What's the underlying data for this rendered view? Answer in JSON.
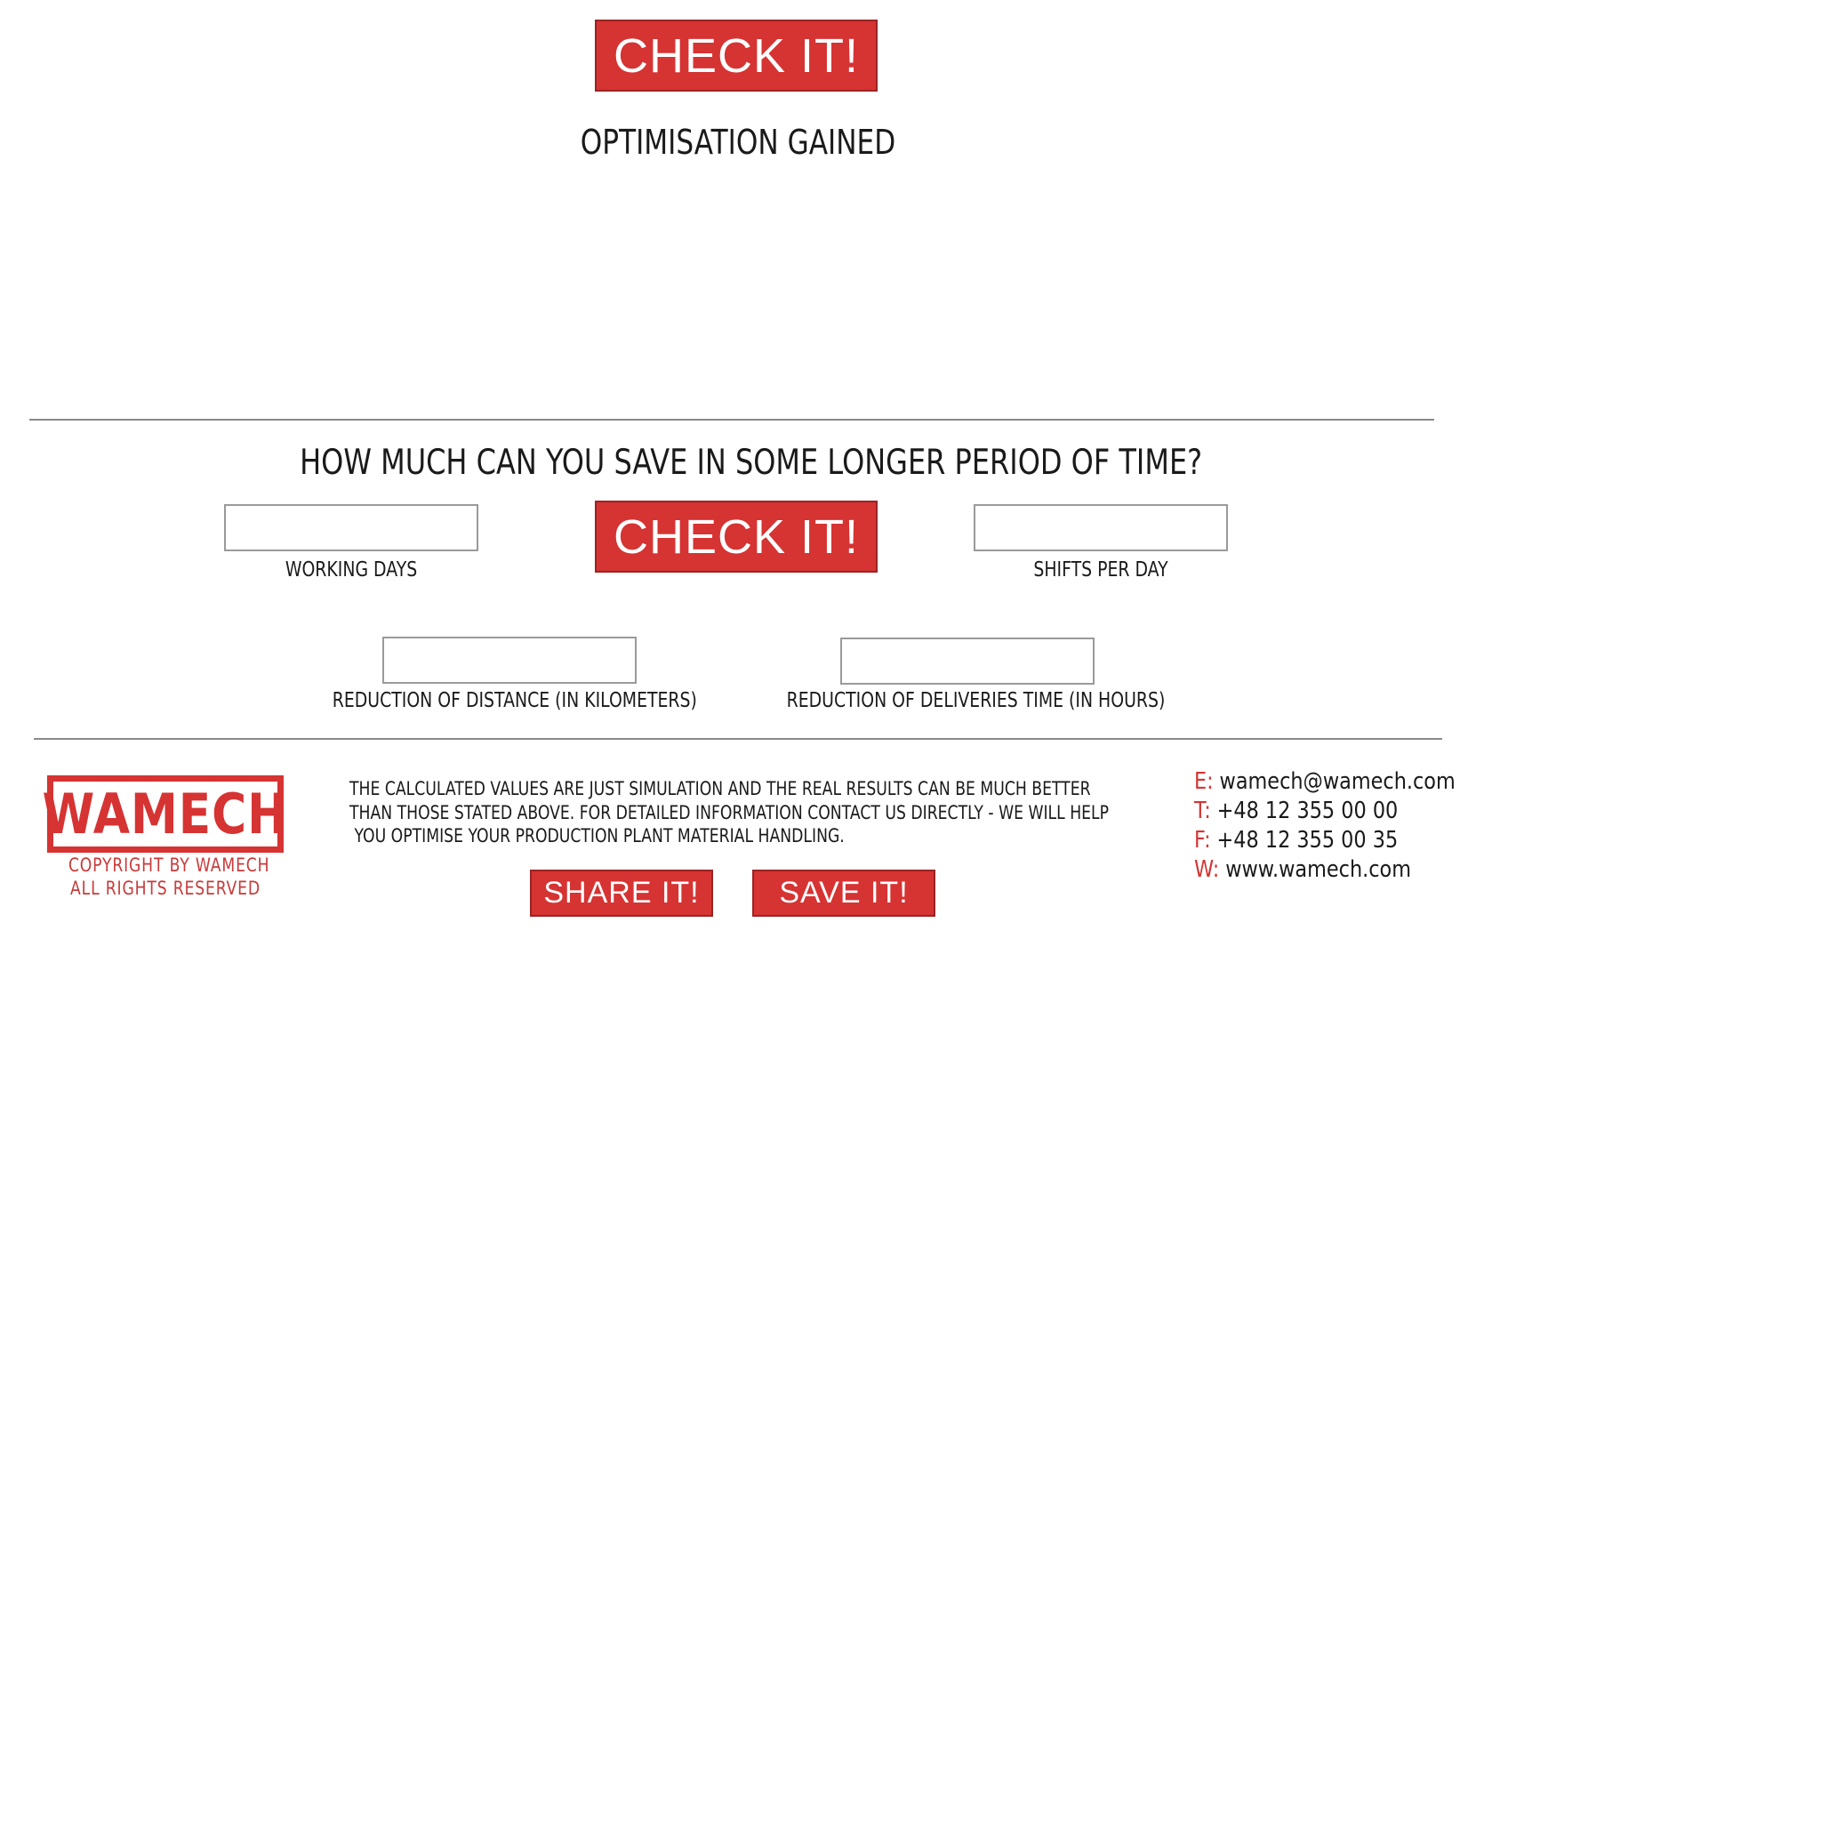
{
  "top": {
    "check_button_label": "CHECK IT!",
    "result_title": "OPTIMISATION GAINED"
  },
  "period": {
    "question": "HOW MUCH CAN YOU SAVE IN SOME LONGER PERIOD OF TIME?",
    "check_button_label": "CHECK IT!",
    "fields": {
      "working_days": {
        "label": "WORKING DAYS",
        "value": ""
      },
      "shifts_per_day": {
        "label": "SHIFTS PER DAY",
        "value": ""
      },
      "distance_reduction": {
        "label": "REDUCTION OF DISTANCE (IN KILOMETERS)",
        "value": ""
      },
      "delivery_time_reduction": {
        "label": "REDUCTION OF DELIVERIES TIME  (IN HOURS)",
        "value": ""
      }
    }
  },
  "footer": {
    "logo_text": "WAMECH",
    "copyright_line1": "COPYRIGHT BY WAMECH",
    "copyright_line2": "ALL RIGHTS RESERVED",
    "disclaimer_lines": [
      "THE CALCULATED VALUES ARE JUST SIMULATION AND THE REAL RESULTS CAN BE MUCH BETTER",
      "THAN THOSE STATED ABOVE. FOR DETAILED INFORMATION CONTACT US DIRECTLY - WE WILL HELP",
      " YOU OPTIMISE YOUR PRODUCTION PLANT MATERIAL HANDLING."
    ],
    "share_button_label": "SHARE IT!",
    "save_button_label": "SAVE IT!",
    "contact": {
      "email_key": "E:",
      "email": "wamech@wamech.com",
      "phone_key": "T:",
      "phone": "+48 12 355 00 00",
      "fax_key": "F:",
      "fax": "+48 12 355 00 35",
      "web_key": "W:",
      "web": "www.wamech.com"
    }
  },
  "colors": {
    "accent_red": "#d63333",
    "text": "#1a1a1a",
    "rule": "#8a8a8a"
  }
}
